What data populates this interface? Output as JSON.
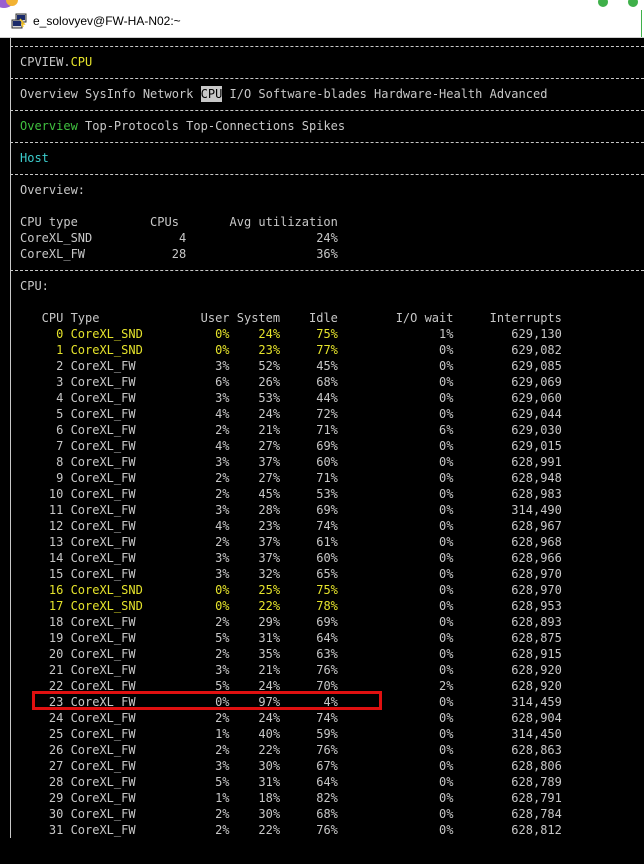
{
  "window": {
    "title": "e_solovyev@FW-HA-N02:~",
    "icon": "putty-icon"
  },
  "terminal": {
    "screen_title": {
      "prefix": "CPVIEW.",
      "current": "CPU"
    },
    "main_tabs": [
      "Overview",
      "SysInfo",
      "Network",
      "CPU",
      "I/O",
      "Software-blades",
      "Hardware-Health",
      "Advanced"
    ],
    "main_tab_selected": "CPU",
    "sub_tabs": [
      "Overview",
      "Top-Protocols",
      "Top-Connections",
      "Spikes"
    ],
    "sub_tab_selected": "Overview",
    "host_label": "Host",
    "overview": {
      "heading": "Overview:",
      "headers": [
        "CPU type",
        "CPUs",
        "Avg utilization"
      ],
      "rows": [
        {
          "type": "CoreXL_SND",
          "cpus": "4",
          "avg": "24%"
        },
        {
          "type": "CoreXL_FW",
          "cpus": "28",
          "avg": "36%"
        }
      ]
    },
    "cpu": {
      "heading": "CPU:",
      "headers": [
        "CPU",
        "Type",
        "User",
        "System",
        "Idle",
        "I/O wait",
        "Interrupts"
      ],
      "rows": [
        {
          "cpu": "0",
          "type": "CoreXL_SND",
          "user": "0%",
          "system": "24%",
          "idle": "75%",
          "iowait": "1%",
          "interrupts": "629,130"
        },
        {
          "cpu": "1",
          "type": "CoreXL_SND",
          "user": "0%",
          "system": "23%",
          "idle": "77%",
          "iowait": "0%",
          "interrupts": "629,082"
        },
        {
          "cpu": "2",
          "type": "CoreXL_FW",
          "user": "3%",
          "system": "52%",
          "idle": "45%",
          "iowait": "0%",
          "interrupts": "629,085"
        },
        {
          "cpu": "3",
          "type": "CoreXL_FW",
          "user": "6%",
          "system": "26%",
          "idle": "68%",
          "iowait": "0%",
          "interrupts": "629,069"
        },
        {
          "cpu": "4",
          "type": "CoreXL_FW",
          "user": "3%",
          "system": "53%",
          "idle": "44%",
          "iowait": "0%",
          "interrupts": "629,060"
        },
        {
          "cpu": "5",
          "type": "CoreXL_FW",
          "user": "4%",
          "system": "24%",
          "idle": "72%",
          "iowait": "0%",
          "interrupts": "629,044"
        },
        {
          "cpu": "6",
          "type": "CoreXL_FW",
          "user": "2%",
          "system": "21%",
          "idle": "71%",
          "iowait": "6%",
          "interrupts": "629,030"
        },
        {
          "cpu": "7",
          "type": "CoreXL_FW",
          "user": "4%",
          "system": "27%",
          "idle": "69%",
          "iowait": "0%",
          "interrupts": "629,015"
        },
        {
          "cpu": "8",
          "type": "CoreXL_FW",
          "user": "3%",
          "system": "37%",
          "idle": "60%",
          "iowait": "0%",
          "interrupts": "628,991"
        },
        {
          "cpu": "9",
          "type": "CoreXL_FW",
          "user": "2%",
          "system": "27%",
          "idle": "71%",
          "iowait": "0%",
          "interrupts": "628,948"
        },
        {
          "cpu": "10",
          "type": "CoreXL_FW",
          "user": "2%",
          "system": "45%",
          "idle": "53%",
          "iowait": "0%",
          "interrupts": "628,983"
        },
        {
          "cpu": "11",
          "type": "CoreXL_FW",
          "user": "3%",
          "system": "28%",
          "idle": "69%",
          "iowait": "0%",
          "interrupts": "314,490"
        },
        {
          "cpu": "12",
          "type": "CoreXL_FW",
          "user": "4%",
          "system": "23%",
          "idle": "74%",
          "iowait": "0%",
          "interrupts": "628,967"
        },
        {
          "cpu": "13",
          "type": "CoreXL_FW",
          "user": "2%",
          "system": "37%",
          "idle": "61%",
          "iowait": "0%",
          "interrupts": "628,968"
        },
        {
          "cpu": "14",
          "type": "CoreXL_FW",
          "user": "3%",
          "system": "37%",
          "idle": "60%",
          "iowait": "0%",
          "interrupts": "628,966"
        },
        {
          "cpu": "15",
          "type": "CoreXL_FW",
          "user": "3%",
          "system": "32%",
          "idle": "65%",
          "iowait": "0%",
          "interrupts": "628,970"
        },
        {
          "cpu": "16",
          "type": "CoreXL_SND",
          "user": "0%",
          "system": "25%",
          "idle": "75%",
          "iowait": "0%",
          "interrupts": "628,970"
        },
        {
          "cpu": "17",
          "type": "CoreXL_SND",
          "user": "0%",
          "system": "22%",
          "idle": "78%",
          "iowait": "0%",
          "interrupts": "628,953"
        },
        {
          "cpu": "18",
          "type": "CoreXL_FW",
          "user": "2%",
          "system": "29%",
          "idle": "69%",
          "iowait": "0%",
          "interrupts": "628,893"
        },
        {
          "cpu": "19",
          "type": "CoreXL_FW",
          "user": "5%",
          "system": "31%",
          "idle": "64%",
          "iowait": "0%",
          "interrupts": "628,875"
        },
        {
          "cpu": "20",
          "type": "CoreXL_FW",
          "user": "2%",
          "system": "35%",
          "idle": "63%",
          "iowait": "0%",
          "interrupts": "628,915"
        },
        {
          "cpu": "21",
          "type": "CoreXL_FW",
          "user": "3%",
          "system": "21%",
          "idle": "76%",
          "iowait": "0%",
          "interrupts": "628,920"
        },
        {
          "cpu": "22",
          "type": "CoreXL_FW",
          "user": "5%",
          "system": "24%",
          "idle": "70%",
          "iowait": "2%",
          "interrupts": "628,920"
        },
        {
          "cpu": "23",
          "type": "CoreXL_FW",
          "user": "0%",
          "system": "97%",
          "idle": "4%",
          "iowait": "0%",
          "interrupts": "314,459"
        },
        {
          "cpu": "24",
          "type": "CoreXL_FW",
          "user": "2%",
          "system": "24%",
          "idle": "74%",
          "iowait": "0%",
          "interrupts": "628,904"
        },
        {
          "cpu": "25",
          "type": "CoreXL_FW",
          "user": "1%",
          "system": "40%",
          "idle": "59%",
          "iowait": "0%",
          "interrupts": "314,450"
        },
        {
          "cpu": "26",
          "type": "CoreXL_FW",
          "user": "2%",
          "system": "22%",
          "idle": "76%",
          "iowait": "0%",
          "interrupts": "628,863"
        },
        {
          "cpu": "27",
          "type": "CoreXL_FW",
          "user": "3%",
          "system": "30%",
          "idle": "67%",
          "iowait": "0%",
          "interrupts": "628,806"
        },
        {
          "cpu": "28",
          "type": "CoreXL_FW",
          "user": "5%",
          "system": "31%",
          "idle": "64%",
          "iowait": "0%",
          "interrupts": "628,789"
        },
        {
          "cpu": "29",
          "type": "CoreXL_FW",
          "user": "1%",
          "system": "18%",
          "idle": "82%",
          "iowait": "0%",
          "interrupts": "628,791"
        },
        {
          "cpu": "30",
          "type": "CoreXL_FW",
          "user": "2%",
          "system": "30%",
          "idle": "68%",
          "iowait": "0%",
          "interrupts": "628,784"
        },
        {
          "cpu": "31",
          "type": "CoreXL_FW",
          "user": "2%",
          "system": "22%",
          "idle": "76%",
          "iowait": "0%",
          "interrupts": "628,812"
        }
      ],
      "highlighted_cpu": "23"
    }
  },
  "colors": {
    "background": "#000000",
    "text": "#c8c8c8",
    "snd_rows": "#e5e32b",
    "host": "#3ccdcd",
    "selected_subtab": "#3fc03f",
    "annotation_box": "#e01010"
  }
}
